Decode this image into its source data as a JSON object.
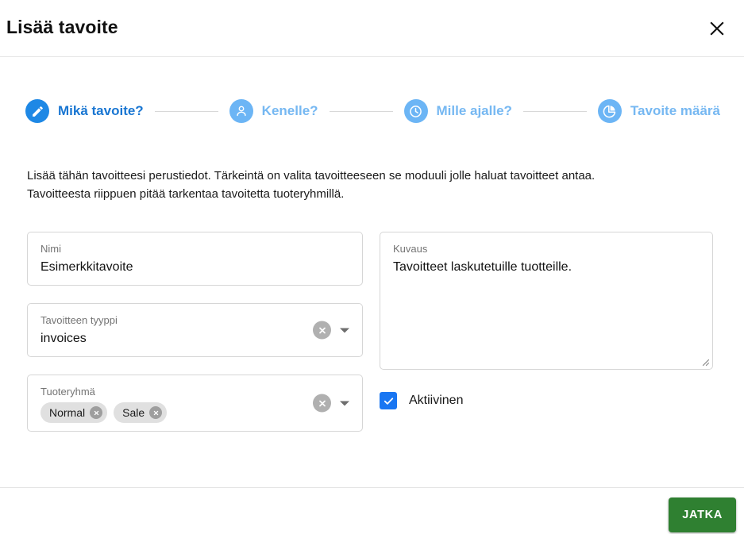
{
  "header": {
    "title": "Lisää tavoite",
    "close_icon": "close-icon"
  },
  "stepper": {
    "steps": [
      {
        "label": "Mikä tavoite?",
        "icon": "pencil-icon",
        "state": "active"
      },
      {
        "label": "Kenelle?",
        "icon": "person-icon",
        "state": "inactive"
      },
      {
        "label": "Mille ajalle?",
        "icon": "clock-icon",
        "state": "inactive"
      },
      {
        "label": "Tavoite määrä",
        "icon": "pie-chart-icon",
        "state": "inactive"
      }
    ]
  },
  "description": {
    "line1": "Lisää tähän tavoitteesi perustiedot. Tärkeintä on valita tavoitteeseen se moduuli jolle haluat tavoitteet antaa.",
    "line2": "Tavoitteesta riippuen pitää tarkentaa tavoitetta tuoteryhmillä."
  },
  "form": {
    "name_field": {
      "label": "Nimi",
      "value": "Esimerkkitavoite"
    },
    "type_field": {
      "label": "Tavoitteen tyyppi",
      "value": "invoices",
      "clear_icon": "clear-circle-icon",
      "caret_icon": "chevron-down-icon"
    },
    "product_group_field": {
      "label": "Tuoteryhmä",
      "chips": [
        {
          "label": "Normal",
          "remove_icon": "chip-remove-icon"
        },
        {
          "label": "Sale",
          "remove_icon": "chip-remove-icon"
        }
      ],
      "clear_icon": "clear-circle-icon",
      "caret_icon": "chevron-down-icon"
    },
    "description_field": {
      "label": "Kuvaus",
      "value": "Tavoitteet laskutetuille tuotteille.",
      "resize_icon": "resize-grip-icon"
    },
    "active_checkbox": {
      "label": "Aktiivinen",
      "checked": true,
      "check_icon": "checkmark-icon"
    }
  },
  "footer": {
    "continue_label": "JATKA"
  },
  "colors": {
    "accent_blue": "#1E88E5",
    "step_inactive_blue": "#6CB5F5",
    "step_label_active": "#1976D2",
    "step_label_inactive": "#76B8F2",
    "checkbox_blue": "#1976f2",
    "primary_green": "#2f8031",
    "chip_gray": "#e0e0e0",
    "border_gray": "#d6d6d6"
  }
}
